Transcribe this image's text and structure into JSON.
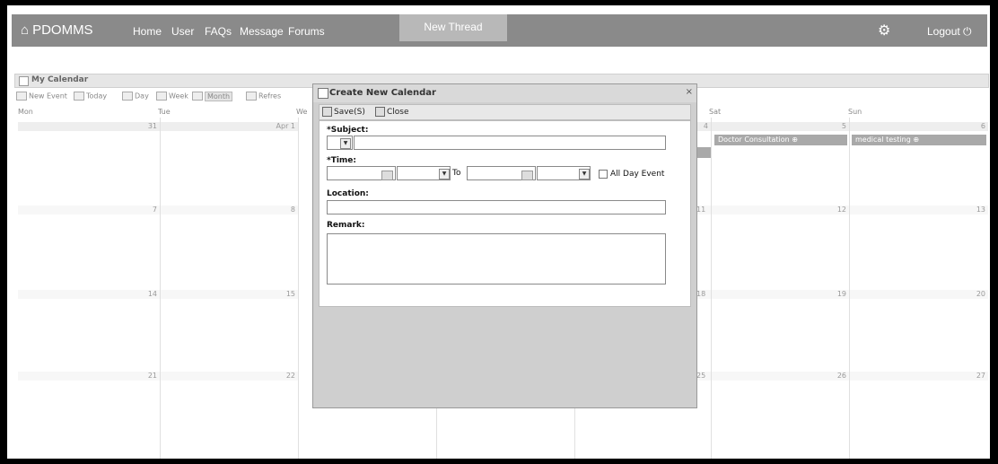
{
  "nav": {
    "brand": "PDOMMS",
    "links": [
      "Home",
      "User",
      "FAQs",
      "Message",
      "Forums"
    ],
    "active": "New Thread",
    "logout": "Logout"
  },
  "calendar": {
    "title": "My Calendar",
    "toolbar": {
      "new_event": "New Event",
      "today": "Today",
      "day": "Day",
      "week": "Week",
      "month": "Month",
      "refresh": "Refres"
    },
    "day_headers": [
      "Mon",
      "Tue",
      "We",
      "Sat",
      "Sun"
    ],
    "week1": {
      "mon": "31",
      "tue": "Apr 1",
      "thu": "4",
      "sat": "5",
      "sun": "6"
    },
    "week2": {
      "mon": "7",
      "tue": "8",
      "fri": "11",
      "sat": "12",
      "sun": "13"
    },
    "week3": {
      "mon": "14",
      "tue": "15",
      "fri": "18",
      "sat": "19",
      "sun": "20"
    },
    "week4": {
      "mon": "21",
      "tue": "22",
      "fri": "25",
      "sat": "26",
      "sun": "27"
    },
    "events": {
      "sat": "Doctor Consultation",
      "sun": "medical testing"
    }
  },
  "modal": {
    "title": "Create New Calendar",
    "close_x": "×",
    "save_label": "Save(S)",
    "close_label": "Close",
    "subject_label": "*Subject:",
    "time_label": "*Time:",
    "to_label": "To",
    "all_day_label": "All Day Event",
    "location_label": "Location:",
    "remark_label": "Remark:",
    "subject_value": "",
    "location_value": "",
    "remark_value": ""
  }
}
